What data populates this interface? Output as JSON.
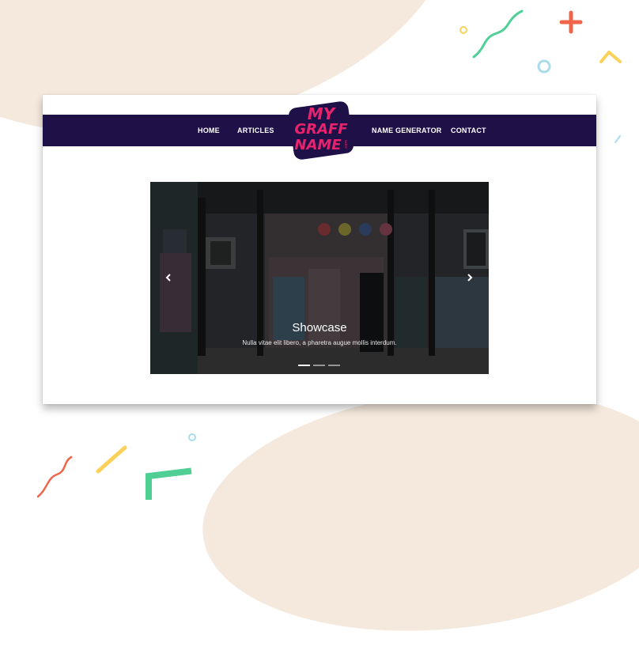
{
  "nav": {
    "items": [
      {
        "label": "HOME"
      },
      {
        "label": "ARTICLES"
      },
      {
        "label": "NAME GENERATOR"
      },
      {
        "label": "CONTACT"
      }
    ],
    "logo": {
      "line1": "MY",
      "line2": "GRAFF",
      "line3": "NAME",
      "tag": ".com"
    }
  },
  "carousel": {
    "title": "Showcase",
    "text": "Nulla vitae elit libero, a pharetra augue mollis interdum.",
    "slide_count": 3,
    "active_slide": 1
  },
  "colors": {
    "navbar": "#1f1147",
    "logo_pink": "#e8236d",
    "page_bg_blob": "#f5e9dd",
    "confetti_green": "#4fcf94",
    "confetti_orange": "#f0654a",
    "confetti_yellow": "#fcd15a",
    "confetti_blue": "#a9dcef"
  },
  "icons": [
    "chevron-left-icon",
    "chevron-right-icon"
  ]
}
